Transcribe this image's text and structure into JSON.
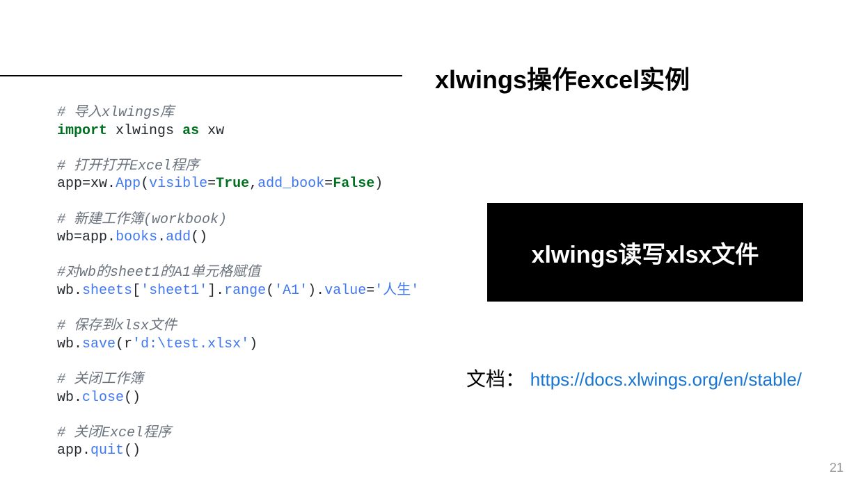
{
  "title": "xlwings操作excel实例",
  "code": {
    "c1": "# 导入xlwings库",
    "kw_import": "import",
    "kw_as": "as",
    "mod": "xlwings",
    "alias": "xw",
    "c2": "# 打开打开Excel程序",
    "l_app": "app",
    "l_eq": "=",
    "l_xw": "xw",
    "l_dot": ".",
    "l_App": "App",
    "l_lp": "(",
    "l_visible": "visible",
    "l_True": "True",
    "l_comma": ",",
    "l_addbook": "add_book",
    "l_False": "False",
    "l_rp": ")",
    "c3": "# 新建工作簿(workbook)",
    "l_wb": "wb",
    "l_books": "books",
    "l_add": "add",
    "l_empty": "()",
    "c4": "#对wb的sheet1的A1单元格赋值",
    "l_sheets": "sheets",
    "l_lb": "[",
    "l_sheet1": "'sheet1'",
    "l_rb": "]",
    "l_range": "range",
    "l_A1": "'A1'",
    "l_value": "value",
    "l_rensheng": "'人生'",
    "c5": "# 保存到xlsx文件",
    "l_save": "save",
    "l_r": "r",
    "l_path": "'d:\\test.xlsx'",
    "c6": "# 关闭工作簿",
    "l_close": "close",
    "c7": "# 关闭Excel程序",
    "l_quit": "quit"
  },
  "box_text": "xlwings读写xlsx文件",
  "doc_label": "文档：",
  "doc_url": "https://docs.xlwings.org/en/stable/",
  "page_number": "21"
}
